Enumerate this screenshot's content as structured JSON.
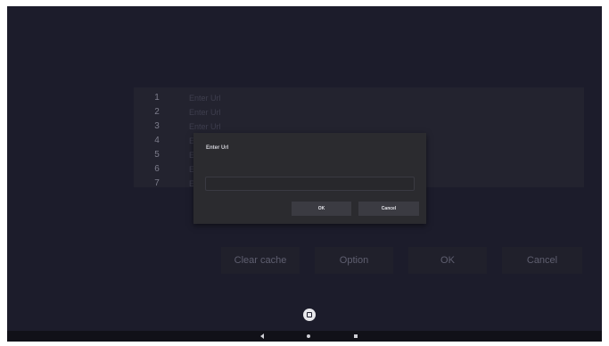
{
  "url_list": {
    "rows": [
      {
        "num": "1",
        "text": "Enter Url"
      },
      {
        "num": "2",
        "text": "Enter Url"
      },
      {
        "num": "3",
        "text": "Enter Url"
      },
      {
        "num": "4",
        "text": "E"
      },
      {
        "num": "5",
        "text": "E"
      },
      {
        "num": "6",
        "text": "E"
      },
      {
        "num": "7",
        "text": "E"
      }
    ]
  },
  "actions": {
    "clear_cache": "Clear cache",
    "option": "Option",
    "ok": "OK",
    "cancel": "Cancel"
  },
  "dialog": {
    "title": "Enter Url",
    "input_value": "",
    "ok": "OK",
    "cancel": "Cancel"
  },
  "nav_icons": [
    "back-icon",
    "home-icon",
    "recents-icon"
  ]
}
